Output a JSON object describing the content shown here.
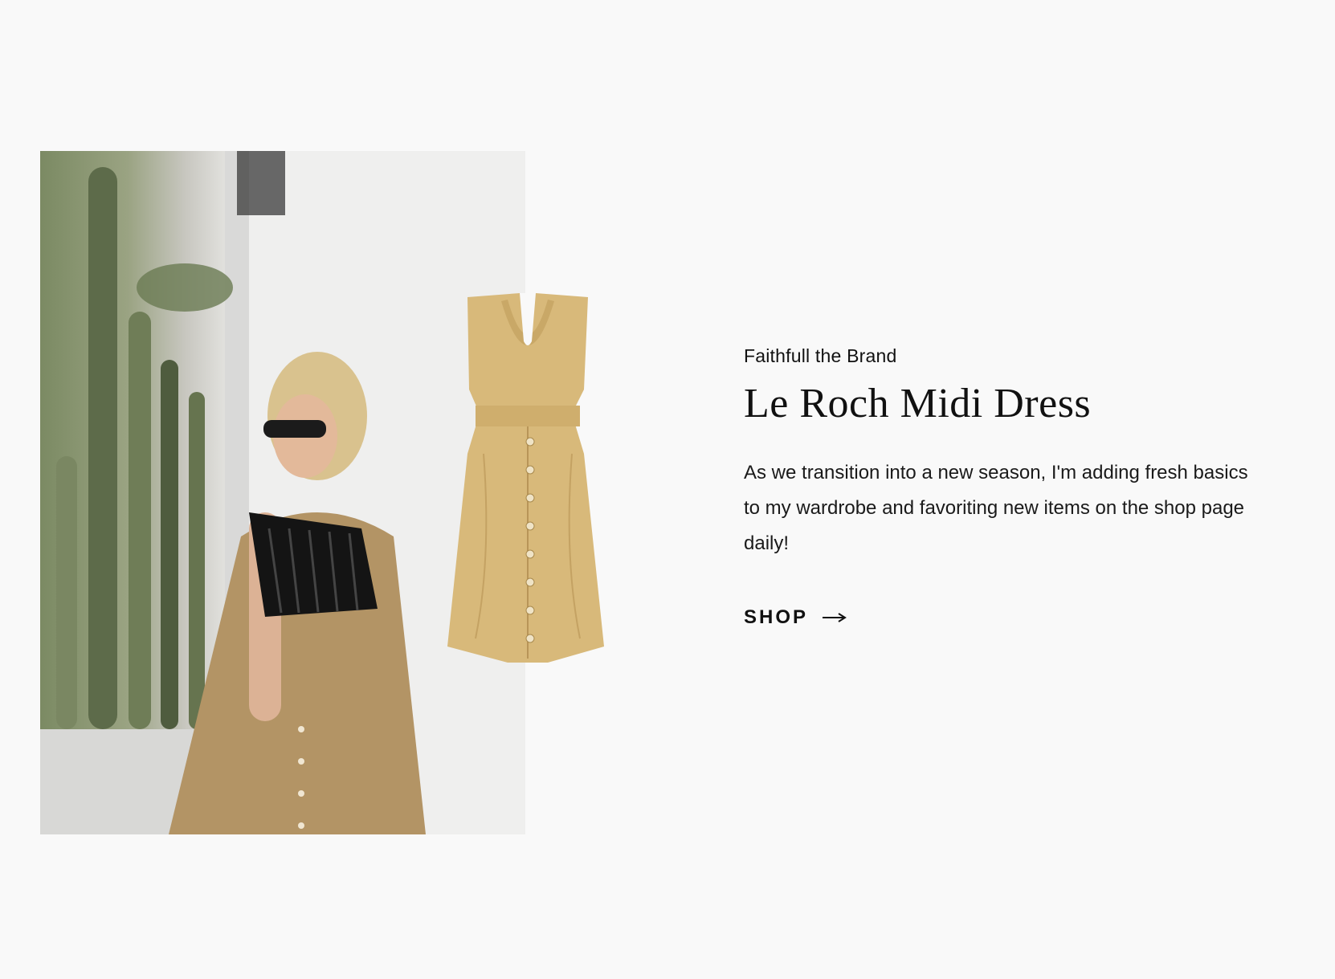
{
  "feature": {
    "brand": "Faithfull the Brand",
    "title": "Le Roch Midi Dress",
    "description": "As we transition into a new season, I'm adding fresh basics to my wardrobe and favoriting new items on the shop page daily!",
    "cta_label": "SHOP",
    "cta_icon": "arrow-right-icon"
  },
  "colors": {
    "background": "#f9f9f9",
    "text": "#111111",
    "dress": "#d8b97a"
  }
}
